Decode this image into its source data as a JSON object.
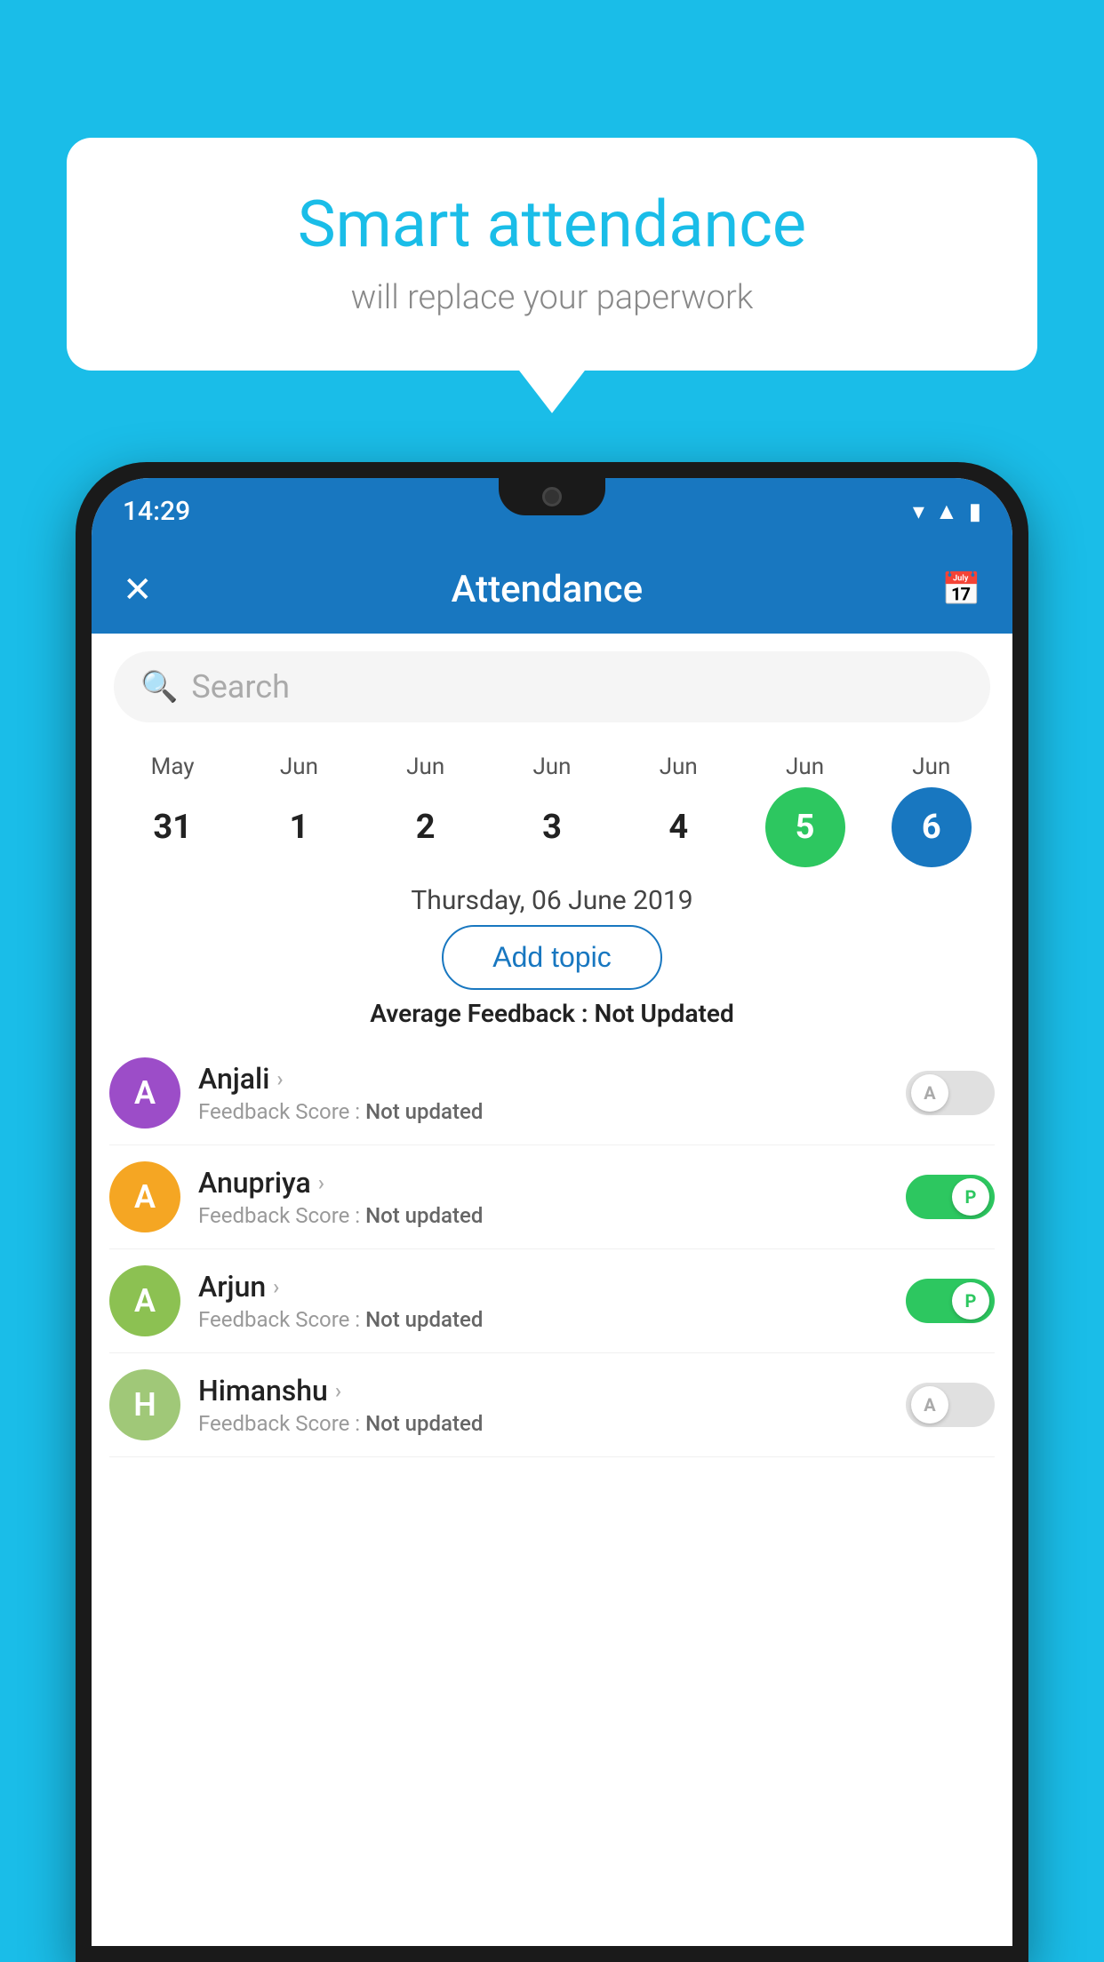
{
  "background_color": "#1ABDE8",
  "bubble": {
    "title": "Smart attendance",
    "subtitle": "will replace your paperwork"
  },
  "status_bar": {
    "time": "14:29",
    "wifi_icon": "▾",
    "signal_icon": "▲",
    "battery_icon": "▮"
  },
  "header": {
    "close_icon": "✕",
    "title": "Attendance",
    "calendar_icon": "📅"
  },
  "search": {
    "placeholder": "Search",
    "icon": "🔍"
  },
  "calendar": {
    "dates": [
      {
        "month": "May",
        "day": "31",
        "style": "normal"
      },
      {
        "month": "Jun",
        "day": "1",
        "style": "normal"
      },
      {
        "month": "Jun",
        "day": "2",
        "style": "normal"
      },
      {
        "month": "Jun",
        "day": "3",
        "style": "normal"
      },
      {
        "month": "Jun",
        "day": "4",
        "style": "normal"
      },
      {
        "month": "Jun",
        "day": "5",
        "style": "today"
      },
      {
        "month": "Jun",
        "day": "6",
        "style": "selected"
      }
    ]
  },
  "selected_date_label": "Thursday, 06 June 2019",
  "add_topic_label": "Add topic",
  "avg_feedback_label": "Average Feedback : ",
  "avg_feedback_value": "Not Updated",
  "students": [
    {
      "name": "Anjali",
      "avatar_letter": "A",
      "avatar_color": "#9C4DC8",
      "feedback_label": "Feedback Score : ",
      "feedback_value": "Not updated",
      "toggle": "off",
      "toggle_label": "A"
    },
    {
      "name": "Anupriya",
      "avatar_letter": "A",
      "avatar_color": "#F5A623",
      "feedback_label": "Feedback Score : ",
      "feedback_value": "Not updated",
      "toggle": "on",
      "toggle_label": "P"
    },
    {
      "name": "Arjun",
      "avatar_letter": "A",
      "avatar_color": "#8CC152",
      "feedback_label": "Feedback Score : ",
      "feedback_value": "Not updated",
      "toggle": "on",
      "toggle_label": "P"
    },
    {
      "name": "Himanshu",
      "avatar_letter": "H",
      "avatar_color": "#A0C878",
      "feedback_label": "Feedback Score : ",
      "feedback_value": "Not updated",
      "toggle": "off",
      "toggle_label": "A"
    }
  ]
}
